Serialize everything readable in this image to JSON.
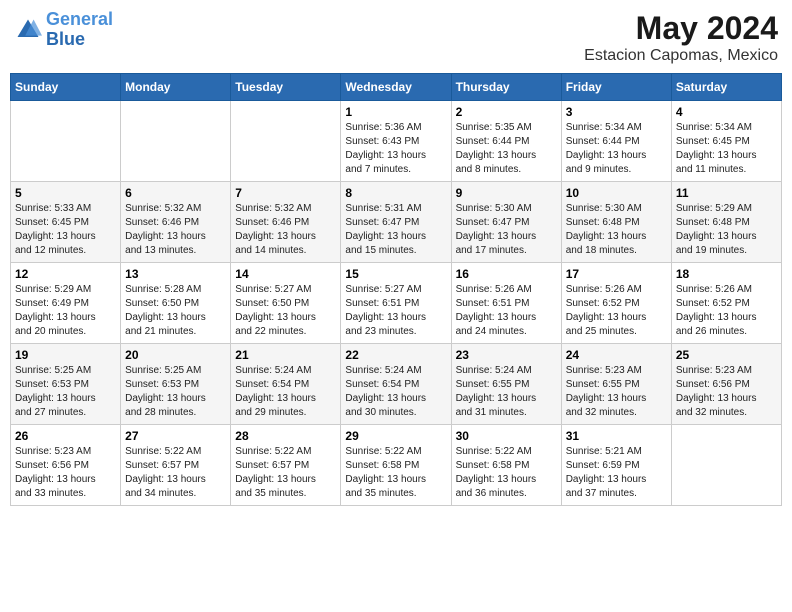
{
  "header": {
    "logo_line1": "General",
    "logo_line2": "Blue",
    "month_year": "May 2024",
    "location": "Estacion Capomas, Mexico"
  },
  "days_of_week": [
    "Sunday",
    "Monday",
    "Tuesday",
    "Wednesday",
    "Thursday",
    "Friday",
    "Saturday"
  ],
  "weeks": [
    [
      {
        "day": "",
        "info": ""
      },
      {
        "day": "",
        "info": ""
      },
      {
        "day": "",
        "info": ""
      },
      {
        "day": "1",
        "info": "Sunrise: 5:36 AM\nSunset: 6:43 PM\nDaylight: 13 hours\nand 7 minutes."
      },
      {
        "day": "2",
        "info": "Sunrise: 5:35 AM\nSunset: 6:44 PM\nDaylight: 13 hours\nand 8 minutes."
      },
      {
        "day": "3",
        "info": "Sunrise: 5:34 AM\nSunset: 6:44 PM\nDaylight: 13 hours\nand 9 minutes."
      },
      {
        "day": "4",
        "info": "Sunrise: 5:34 AM\nSunset: 6:45 PM\nDaylight: 13 hours\nand 11 minutes."
      }
    ],
    [
      {
        "day": "5",
        "info": "Sunrise: 5:33 AM\nSunset: 6:45 PM\nDaylight: 13 hours\nand 12 minutes."
      },
      {
        "day": "6",
        "info": "Sunrise: 5:32 AM\nSunset: 6:46 PM\nDaylight: 13 hours\nand 13 minutes."
      },
      {
        "day": "7",
        "info": "Sunrise: 5:32 AM\nSunset: 6:46 PM\nDaylight: 13 hours\nand 14 minutes."
      },
      {
        "day": "8",
        "info": "Sunrise: 5:31 AM\nSunset: 6:47 PM\nDaylight: 13 hours\nand 15 minutes."
      },
      {
        "day": "9",
        "info": "Sunrise: 5:30 AM\nSunset: 6:47 PM\nDaylight: 13 hours\nand 17 minutes."
      },
      {
        "day": "10",
        "info": "Sunrise: 5:30 AM\nSunset: 6:48 PM\nDaylight: 13 hours\nand 18 minutes."
      },
      {
        "day": "11",
        "info": "Sunrise: 5:29 AM\nSunset: 6:48 PM\nDaylight: 13 hours\nand 19 minutes."
      }
    ],
    [
      {
        "day": "12",
        "info": "Sunrise: 5:29 AM\nSunset: 6:49 PM\nDaylight: 13 hours\nand 20 minutes."
      },
      {
        "day": "13",
        "info": "Sunrise: 5:28 AM\nSunset: 6:50 PM\nDaylight: 13 hours\nand 21 minutes."
      },
      {
        "day": "14",
        "info": "Sunrise: 5:27 AM\nSunset: 6:50 PM\nDaylight: 13 hours\nand 22 minutes."
      },
      {
        "day": "15",
        "info": "Sunrise: 5:27 AM\nSunset: 6:51 PM\nDaylight: 13 hours\nand 23 minutes."
      },
      {
        "day": "16",
        "info": "Sunrise: 5:26 AM\nSunset: 6:51 PM\nDaylight: 13 hours\nand 24 minutes."
      },
      {
        "day": "17",
        "info": "Sunrise: 5:26 AM\nSunset: 6:52 PM\nDaylight: 13 hours\nand 25 minutes."
      },
      {
        "day": "18",
        "info": "Sunrise: 5:26 AM\nSunset: 6:52 PM\nDaylight: 13 hours\nand 26 minutes."
      }
    ],
    [
      {
        "day": "19",
        "info": "Sunrise: 5:25 AM\nSunset: 6:53 PM\nDaylight: 13 hours\nand 27 minutes."
      },
      {
        "day": "20",
        "info": "Sunrise: 5:25 AM\nSunset: 6:53 PM\nDaylight: 13 hours\nand 28 minutes."
      },
      {
        "day": "21",
        "info": "Sunrise: 5:24 AM\nSunset: 6:54 PM\nDaylight: 13 hours\nand 29 minutes."
      },
      {
        "day": "22",
        "info": "Sunrise: 5:24 AM\nSunset: 6:54 PM\nDaylight: 13 hours\nand 30 minutes."
      },
      {
        "day": "23",
        "info": "Sunrise: 5:24 AM\nSunset: 6:55 PM\nDaylight: 13 hours\nand 31 minutes."
      },
      {
        "day": "24",
        "info": "Sunrise: 5:23 AM\nSunset: 6:55 PM\nDaylight: 13 hours\nand 32 minutes."
      },
      {
        "day": "25",
        "info": "Sunrise: 5:23 AM\nSunset: 6:56 PM\nDaylight: 13 hours\nand 32 minutes."
      }
    ],
    [
      {
        "day": "26",
        "info": "Sunrise: 5:23 AM\nSunset: 6:56 PM\nDaylight: 13 hours\nand 33 minutes."
      },
      {
        "day": "27",
        "info": "Sunrise: 5:22 AM\nSunset: 6:57 PM\nDaylight: 13 hours\nand 34 minutes."
      },
      {
        "day": "28",
        "info": "Sunrise: 5:22 AM\nSunset: 6:57 PM\nDaylight: 13 hours\nand 35 minutes."
      },
      {
        "day": "29",
        "info": "Sunrise: 5:22 AM\nSunset: 6:58 PM\nDaylight: 13 hours\nand 35 minutes."
      },
      {
        "day": "30",
        "info": "Sunrise: 5:22 AM\nSunset: 6:58 PM\nDaylight: 13 hours\nand 36 minutes."
      },
      {
        "day": "31",
        "info": "Sunrise: 5:21 AM\nSunset: 6:59 PM\nDaylight: 13 hours\nand 37 minutes."
      },
      {
        "day": "",
        "info": ""
      }
    ]
  ]
}
